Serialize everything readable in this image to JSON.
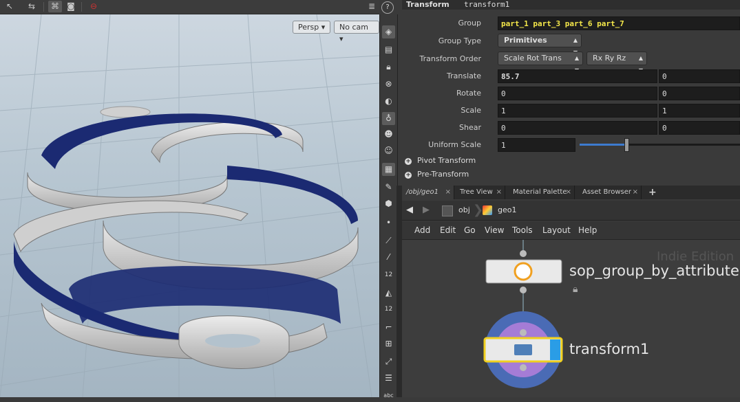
{
  "viewport": {
    "toolbar_icons": [
      "select-arrow-icon",
      "transform-arrows-icon",
      "snap-icon",
      "camera-icon",
      "record-icon"
    ],
    "persp_label": "Persp",
    "cam_label": "No cam",
    "dropdown_glyph": "▾",
    "colors": {
      "ring_face": "#d8d8d8",
      "ring_back": "#1a2a6e",
      "grid_bg": "#b3c2cd"
    }
  },
  "shelf": {
    "icons": [
      "display-options-icon",
      "view-icon",
      "lock-icon",
      "pin-icon",
      "light-icon",
      "bulb-icon",
      "skull-icon",
      "skull-outline-icon",
      "texture-icon",
      "paint-icon",
      "geometry-icon",
      "point-icon",
      "brush-icon",
      "picker-icon",
      "number-12-icon",
      "eraser-icon",
      "number-12-stack-icon",
      "wedge-icon",
      "grid-icon",
      "tweak-icon",
      "menu-icon"
    ],
    "badge_12": "12",
    "abc": "abc"
  },
  "params": {
    "header_op": "Transform",
    "header_name": "transform1",
    "rows": [
      {
        "label": "Group",
        "value": "part_1 part_3 part_6 part_7"
      },
      {
        "label": "Group Type",
        "value": "Primitives"
      },
      {
        "label": "Transform Order",
        "value": "Scale Rot Trans",
        "value2": "Rx Ry Rz"
      },
      {
        "label": "Translate",
        "x": "85.7",
        "y": "0"
      },
      {
        "label": "Rotate",
        "x": "0",
        "y": "0"
      },
      {
        "label": "Scale",
        "x": "1",
        "y": "1"
      },
      {
        "label": "Shear",
        "x": "0",
        "y": "0"
      },
      {
        "label": "Uniform Scale",
        "x": "1",
        "slider": 0.29
      }
    ],
    "folders": [
      "Pivot Transform",
      "Pre-Transform"
    ],
    "group_color": "#f5e84a"
  },
  "tabs": [
    {
      "label": "/obj/geo1",
      "active": true
    },
    {
      "label": "Tree View"
    },
    {
      "label": "Material Palette"
    },
    {
      "label": "Asset Browser"
    }
  ],
  "tab_close": "×",
  "tab_add": "+",
  "path": {
    "seg1": "obj",
    "seg2": "geo1"
  },
  "menu": [
    "Add",
    "Edit",
    "Go",
    "View",
    "Tools",
    "Layout",
    "Help"
  ],
  "network": {
    "watermark": "Indie Edition",
    "nodes": [
      {
        "name": "sop_group_by_attribute"
      },
      {
        "name": "transform1"
      }
    ],
    "selected_color": "#f0d020",
    "ring_outer": "#4a6bb5",
    "ring_inner": "#a57cd6"
  }
}
